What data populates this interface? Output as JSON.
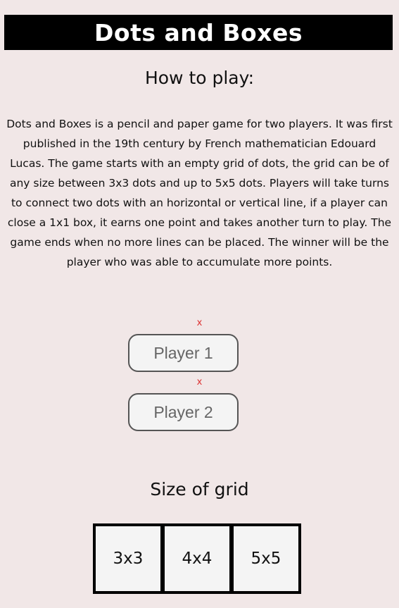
{
  "header": {
    "title": "Dots and Boxes"
  },
  "how_to_play": {
    "heading": "How to play:",
    "text": "Dots and Boxes is a pencil and paper game for two players. It was first published in the 19th century by French mathematician Edouard Lucas. The game starts with an empty grid of dots, the grid can be of any size between 3x3 dots and up to 5x5 dots. Players will take turns to connect two dots with an horizontal or vertical line, if a player can close a 1x1 box, it earns one point and takes another turn to play. The game ends when no more lines can be placed. The winner will be the player who was able to accumulate more points."
  },
  "players": {
    "player1": {
      "placeholder": "Player 1",
      "value": "",
      "validation_mark": "x"
    },
    "player2": {
      "placeholder": "Player 2",
      "value": "",
      "validation_mark": "x"
    }
  },
  "grid_size": {
    "heading": "Size of grid",
    "options": [
      "3x3",
      "4x4",
      "5x5"
    ]
  },
  "colors": {
    "background": "#f1e7e7",
    "header_bg": "#000000",
    "header_text": "#ffffff",
    "validation_mark": "#dd3333",
    "option_bg": "#f4f4f4"
  }
}
